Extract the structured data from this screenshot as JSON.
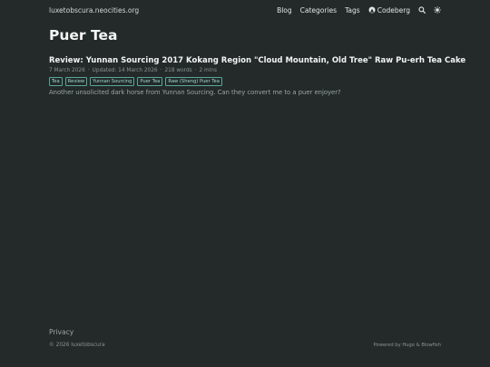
{
  "header": {
    "site_name": "luxetobscura.neocities.org",
    "nav": {
      "blog": "Blog",
      "categories": "Categories",
      "tags": "Tags",
      "codeberg": "Codeberg"
    },
    "icons": {
      "codeberg": "codeberg-icon",
      "search": "search-icon",
      "theme": "sun-icon"
    }
  },
  "page": {
    "title": "Puer Tea"
  },
  "article": {
    "title": "Review: Yunnan Sourcing 2017 Kokang Region \"Cloud Mountain, Old Tree\" Raw Pu-erh Tea Cake",
    "meta": {
      "date": "7 March 2026",
      "updated": "Updated: 14 March 2026",
      "words": "218 words",
      "reading_time": "2 mins"
    },
    "tags": [
      "Tea",
      "Review",
      "Yunnan Sourcing",
      "Puer Tea",
      "Raw (Sheng) Puer Tea"
    ],
    "summary": "Another unsolicited dark horse from Yunnan Sourcing. Can they convert me to a puer enjoyer?"
  },
  "footer": {
    "privacy": "Privacy",
    "copyright": "© 2026 luxetobscura",
    "powered": "Powered by Hugo & Blowfish"
  },
  "colors": {
    "background": "#232a29",
    "tag_border": "#57a898",
    "tag_text": "#9fd9cc"
  }
}
